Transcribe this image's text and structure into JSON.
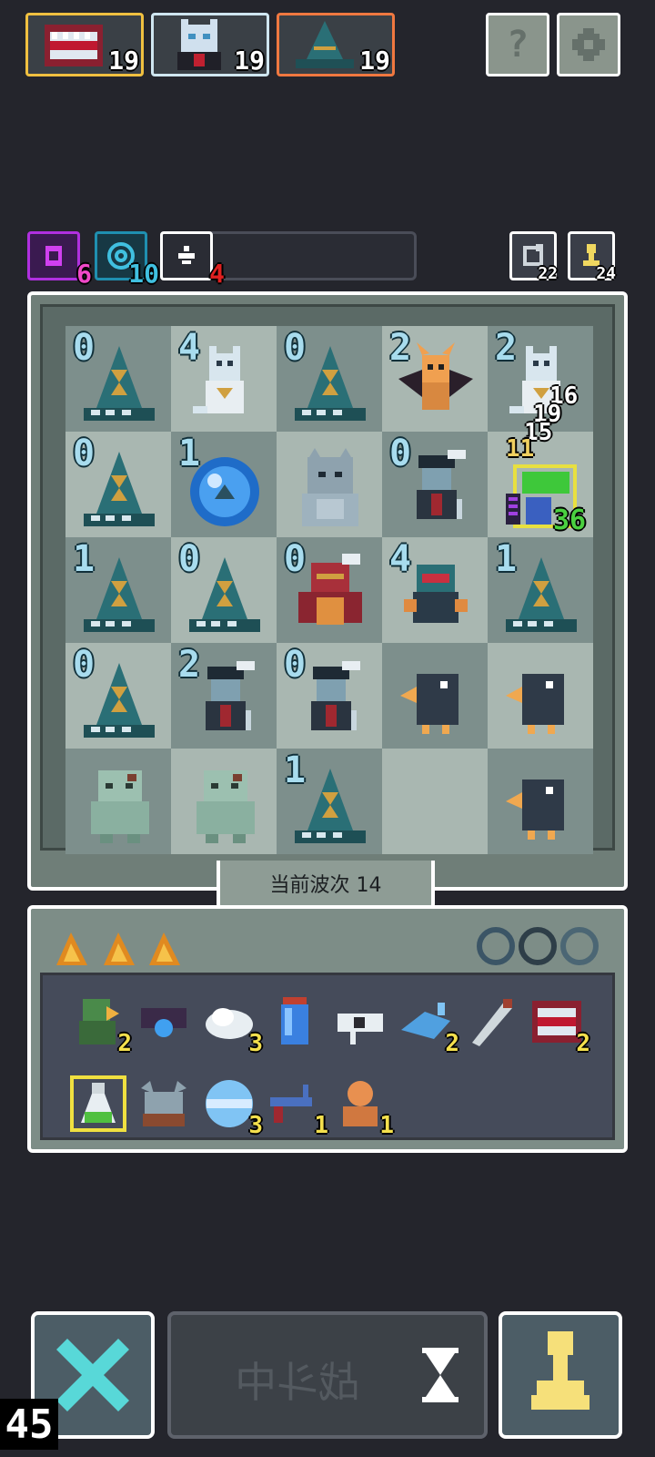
{
  "heroes": [
    {
      "name": "mimic-chest",
      "level": "19",
      "border": "#f0c040"
    },
    {
      "name": "white-cat-vampire",
      "level": "19",
      "border": "#cfe6f0"
    },
    {
      "name": "wizard-hat",
      "level": "19",
      "border": "#f07840"
    }
  ],
  "top_buttons": {
    "help_label": "?",
    "settings_icon": "gear-icon"
  },
  "resources": [
    {
      "icon": "purple-gem-icon",
      "count": "6",
      "color": "#d040f0"
    },
    {
      "icon": "cyan-swirl-icon",
      "count": "10",
      "color": "#40c0e0"
    },
    {
      "icon": "white-spark-icon",
      "count": "4",
      "color": "#e02020"
    }
  ],
  "mini_counters": [
    {
      "icon": "refresh-icon",
      "count": "22"
    },
    {
      "icon": "pawn-icon",
      "count": "24"
    }
  ],
  "board": {
    "cells": [
      {
        "num": "0",
        "unit": "hourglass-hat"
      },
      {
        "num": "4",
        "unit": "cat-knight"
      },
      {
        "num": "0",
        "unit": "hourglass-hat"
      },
      {
        "num": "2",
        "unit": "bat-knight"
      },
      {
        "num": "2",
        "unit": "cat-knight"
      },
      {
        "num": "0",
        "unit": "hourglass-hat"
      },
      {
        "num": "1",
        "unit": "blue-orb"
      },
      {
        "num": "",
        "unit": "grey-yeti"
      },
      {
        "num": "0",
        "unit": "crow-pirate"
      },
      {
        "num": "",
        "unit": "goblin-hero"
      },
      {
        "num": "1",
        "unit": "hourglass-hat"
      },
      {
        "num": "0",
        "unit": "hourglass-hat"
      },
      {
        "num": "0",
        "unit": "red-ogre"
      },
      {
        "num": "4",
        "unit": "red-ogre-small"
      },
      {
        "num": "1",
        "unit": "hourglass-hat"
      },
      {
        "num": "0",
        "unit": "hourglass-hat"
      },
      {
        "num": "2",
        "unit": "crow-pirate"
      },
      {
        "num": "0",
        "unit": "crow-pirate"
      },
      {
        "num": "",
        "unit": "black-bird"
      },
      {
        "num": "",
        "unit": "black-bird"
      },
      {
        "num": "",
        "unit": "zombie"
      },
      {
        "num": "",
        "unit": "zombie"
      },
      {
        "num": "1",
        "unit": "hourglass-hat"
      },
      {
        "num": "",
        "unit": ""
      },
      {
        "num": "",
        "unit": "black-bird"
      }
    ],
    "damage_popups": [
      "16",
      "19",
      "15",
      "11"
    ],
    "hero_level": "36",
    "wave_label": "当前波次 14"
  },
  "inventory": {
    "items": [
      {
        "icon": "green-soldier-icon",
        "count": "2"
      },
      {
        "icon": "blue-amulet-icon",
        "count": ""
      },
      {
        "icon": "white-cloud-icon",
        "count": "3"
      },
      {
        "icon": "blue-potion-icon",
        "count": ""
      },
      {
        "icon": "eye-glyph-icon",
        "count": ""
      },
      {
        "icon": "blue-bird-icon",
        "count": "2"
      },
      {
        "icon": "feather-blade-icon",
        "count": ""
      },
      {
        "icon": "mimic-mouth-icon",
        "count": "2"
      },
      {
        "icon": "green-flask-icon",
        "count": ""
      },
      {
        "icon": "grey-horned-icon",
        "count": ""
      },
      {
        "icon": "ice-orb-icon",
        "count": "3"
      },
      {
        "icon": "blue-gun-icon",
        "count": "1"
      },
      {
        "icon": "orange-bust-icon",
        "count": "1"
      }
    ]
  },
  "bottom": {
    "start_label": "战斗中",
    "timer": "45"
  }
}
